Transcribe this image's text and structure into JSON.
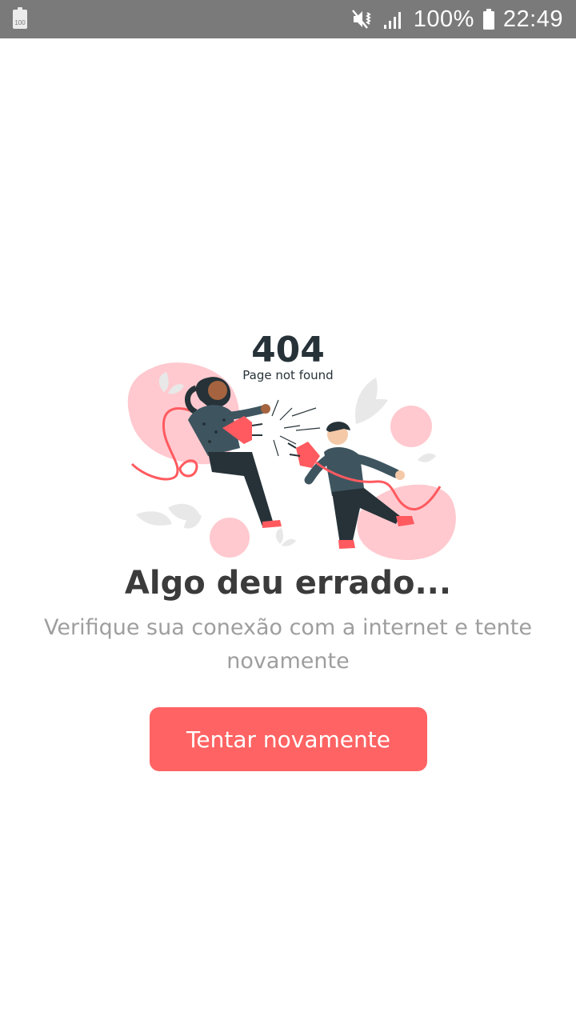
{
  "status_bar": {
    "battery_badge": "100",
    "battery_percent": "100%",
    "time": "22:49",
    "icons": [
      "battery-saver-icon",
      "mute-vibrate-icon",
      "signal-icon",
      "battery-icon"
    ]
  },
  "illustration": {
    "code": "404",
    "caption": "Page not found",
    "colors": {
      "pink": "#ffc9cf",
      "red": "#ff5a5f",
      "dark": "#2f3b45",
      "teal": "#3e5560",
      "leaf": "#e6e6e6"
    }
  },
  "error": {
    "title": "Algo deu errado...",
    "message": "Verifique sua conexão com a internet e tente novamente"
  },
  "retry_button": {
    "label": "Tentar novamente",
    "color": "#ff6363"
  }
}
